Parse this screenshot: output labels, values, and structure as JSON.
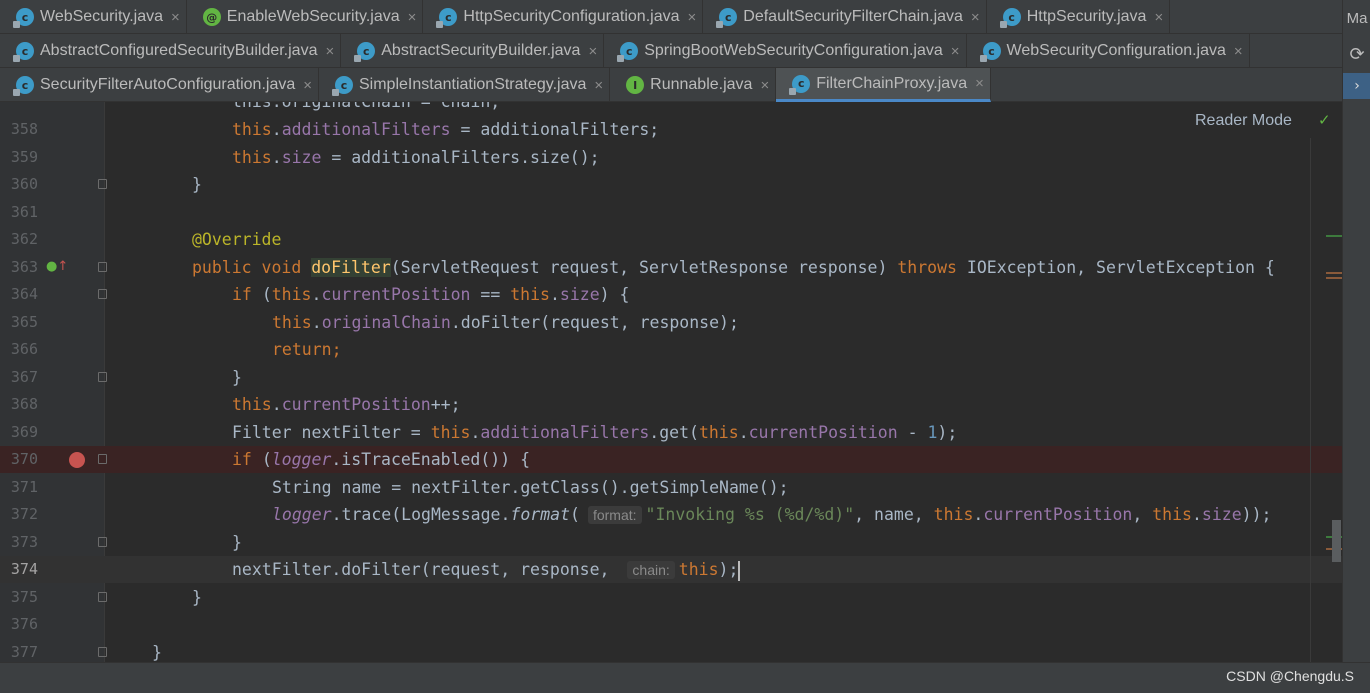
{
  "tabs": {
    "row1": [
      {
        "label": "WebSecurity.java",
        "icon": "c"
      },
      {
        "label": "EnableWebSecurity.java",
        "icon": "@"
      },
      {
        "label": "HttpSecurityConfiguration.java",
        "icon": "c"
      },
      {
        "label": "DefaultSecurityFilterChain.java",
        "icon": "c"
      },
      {
        "label": "HttpSecurity.java",
        "icon": "c"
      }
    ],
    "row2": [
      {
        "label": "AbstractConfiguredSecurityBuilder.java",
        "icon": "c"
      },
      {
        "label": "AbstractSecurityBuilder.java",
        "icon": "c"
      },
      {
        "label": "SpringBootWebSecurityConfiguration.java",
        "icon": "c"
      },
      {
        "label": "WebSecurityConfiguration.java",
        "icon": "c"
      }
    ],
    "row3": [
      {
        "label": "SecurityFilterAutoConfiguration.java",
        "icon": "c"
      },
      {
        "label": "SimpleInstantiationStrategy.java",
        "icon": "c"
      },
      {
        "label": "Runnable.java",
        "icon": "I"
      },
      {
        "label": "FilterChainProxy.java",
        "icon": "c",
        "active": true
      }
    ],
    "close_glyph": "×"
  },
  "right_strip": {
    "top_label": "Ma",
    "refresh_icon": "⟳",
    "expand_icon": "›"
  },
  "editor": {
    "reader_mode": "Reader Mode",
    "reader_check": "✓",
    "partial_line": "this.originalChain = chain;",
    "line_numbers": [
      "358",
      "359",
      "360",
      "361",
      "362",
      "363",
      "364",
      "365",
      "366",
      "367",
      "368",
      "369",
      "370",
      "371",
      "372",
      "373",
      "374",
      "375",
      "376",
      "377"
    ],
    "breakpoint_line": "370",
    "current_line": "374",
    "hints": {
      "format": "format:",
      "chain": "chain:"
    },
    "code": {
      "l358": [
        "this",
        ".",
        "additionalFilters",
        " = additionalFilters;"
      ],
      "l359": [
        "this",
        ".",
        "size",
        " = additionalFilters.size();"
      ],
      "l360": "}",
      "l362": "@Override",
      "l363": [
        "public void ",
        "doFilter",
        "(ServletRequest request, ServletResponse response) ",
        "throws ",
        "IOException, ServletException {"
      ],
      "l364": [
        "if ",
        "(",
        "this",
        ".",
        "currentPosition",
        " == ",
        "this",
        ".",
        "size",
        ") {"
      ],
      "l365": [
        "this",
        ".",
        "originalChain",
        ".doFilter(request, response);"
      ],
      "l366": "return;",
      "l367": "}",
      "l368": [
        "this",
        ".",
        "currentPosition",
        "++;"
      ],
      "l369": [
        "Filter nextFilter = ",
        "this",
        ".",
        "additionalFilters",
        ".get(",
        "this",
        ".",
        "currentPosition",
        " - ",
        "1",
        ");"
      ],
      "l370": [
        "if ",
        "(",
        "logger",
        ".isTraceEnabled()) {"
      ],
      "l371": "String name = nextFilter.getClass().getSimpleName();",
      "l372": [
        "logger",
        ".trace(LogMessage.",
        "format",
        "(",
        "\"Invoking %s (%d/%d)\"",
        ", name, ",
        "this",
        ".",
        "currentPosition",
        ", ",
        "this",
        ".",
        "size",
        "));"
      ],
      "l373": "}",
      "l374": [
        "nextFilter.doFilter(request, response, ",
        "this",
        ");"
      ],
      "l375": "}",
      "l377": "}"
    }
  },
  "status": {
    "watermark": "CSDN @Chengdu.S"
  },
  "colors": {
    "keyword": "#cc7832",
    "field": "#9876aa",
    "annotation": "#bbb529",
    "method": "#ffc66d",
    "number": "#6897bb",
    "string": "#6a8759"
  }
}
